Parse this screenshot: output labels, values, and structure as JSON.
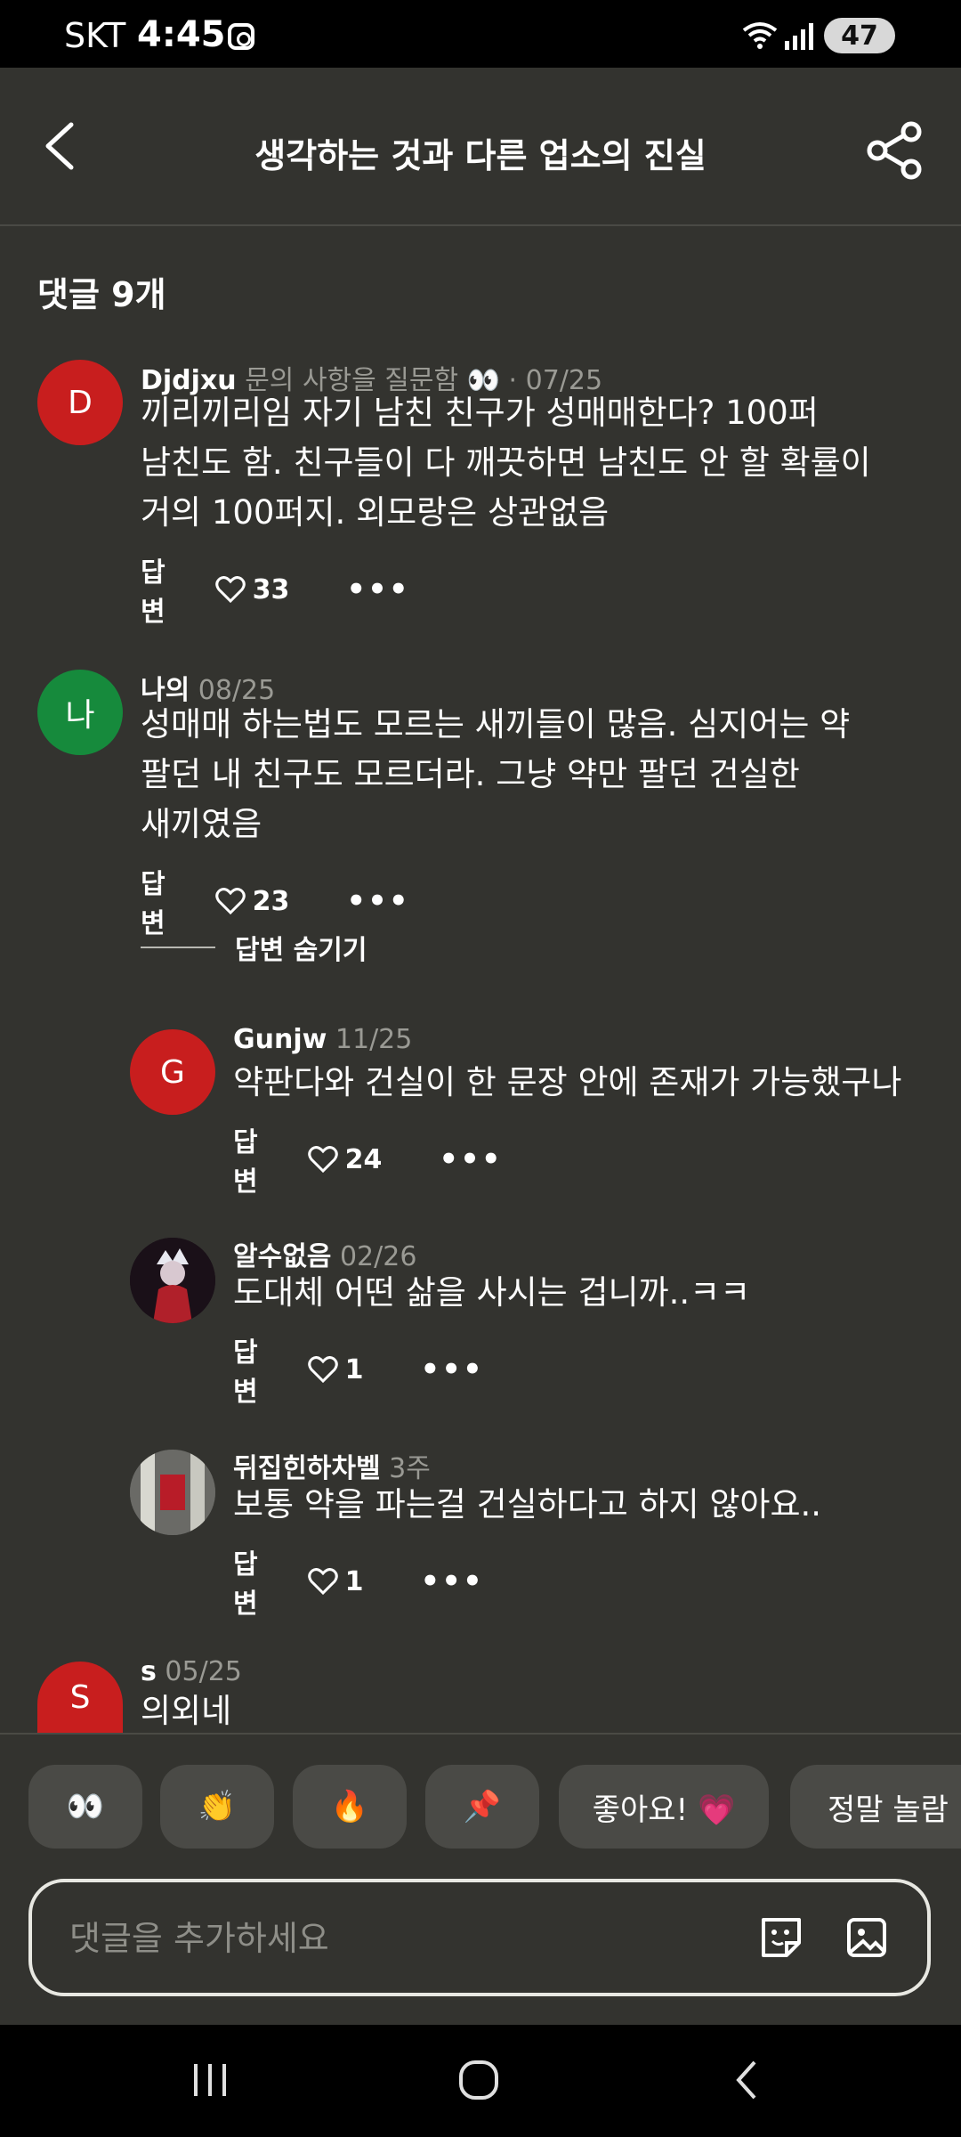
{
  "status_bar": {
    "carrier": "SKT",
    "time": "4:45",
    "battery": "47"
  },
  "header": {
    "title": "생각하는 것과 다른 업소의 진실"
  },
  "comments_section": {
    "count_label": "댓글 9개",
    "hide_replies_label": "답변 숨기기",
    "comments": [
      {
        "avatar_letter": "D",
        "avatar_color": "#c81e1e",
        "author": "Djdjxu",
        "status": "문의 사항을 질문함 👀",
        "separator": "·",
        "date": "07/25",
        "lines": [
          "끼리끼리임 자기 남친 친구가 성매매한다? 100퍼",
          "남친도 함. 친구들이 다 깨끗하면 남친도 안 할 확률이",
          "거의 100퍼지. 외모랑은 상관없음"
        ],
        "reply_label": "답변",
        "likes": "33"
      },
      {
        "avatar_letter": "나",
        "avatar_color": "#168a3c",
        "author": "나의",
        "date": "08/25",
        "lines": [
          "성매매 하는법도 모르는 새끼들이 많음. 심지어는 약",
          "팔던 내 친구도 모르더라. 그냥 약만 팔던 건실한",
          "새끼였음"
        ],
        "reply_label": "답변",
        "likes": "23"
      },
      {
        "avatar_letter": "G",
        "avatar_color": "#c81e1e",
        "author": "Gunjw",
        "date": "11/25",
        "lines": [
          "약판다와 건실이 한 문장 안에 존재가 가능했구나"
        ],
        "reply_label": "답변",
        "likes": "24"
      },
      {
        "avatar_letter": "",
        "avatar_color": "#1a1018",
        "author": "알수없음",
        "date": "02/26",
        "lines": [
          "도대체 어떤 삶을 사시는 겁니까..ㅋㅋ"
        ],
        "reply_label": "답변",
        "likes": "1"
      },
      {
        "avatar_letter": "",
        "avatar_color": "#5a5a58",
        "author": "뒤집힌하차벨",
        "date": "3주",
        "lines": [
          "보통 약을 파는걸 건실하다고 하지 않아요.."
        ],
        "reply_label": "답변",
        "likes": "1"
      },
      {
        "avatar_letter": "S",
        "avatar_color": "#c81e1e",
        "author": "s",
        "date": "05/25",
        "lines": [
          "의외네"
        ]
      }
    ]
  },
  "reactions": [
    "👀",
    "👏",
    "🔥",
    "📌",
    "좋아요! 💗",
    "정말 놀람"
  ],
  "composer": {
    "placeholder": "댓글을 추가하세요"
  },
  "colors": {
    "background": "#33332f",
    "chip": "#4a4a46",
    "muted_text": "#9a9a94"
  }
}
